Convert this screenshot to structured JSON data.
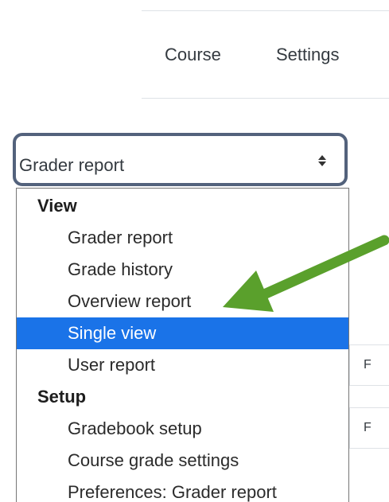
{
  "nav": {
    "tabs": [
      {
        "label": "Course"
      },
      {
        "label": "Settings"
      }
    ]
  },
  "report_select": {
    "selected_value": "Grader report",
    "arrow_icon": "sort-arrows-icon"
  },
  "dropdown": {
    "groups": [
      {
        "label": "View",
        "items": [
          {
            "label": "Grader report"
          },
          {
            "label": "Grade history"
          },
          {
            "label": "Overview report"
          },
          {
            "label": "Single view",
            "highlighted": true
          },
          {
            "label": "User report"
          }
        ]
      },
      {
        "label": "Setup",
        "items": [
          {
            "label": "Gradebook setup"
          },
          {
            "label": "Course grade settings"
          },
          {
            "label": "Preferences: Grader report"
          }
        ]
      }
    ],
    "highlight_color": "#1a73e8"
  },
  "background_table": {
    "cells": [
      "F",
      "F"
    ]
  },
  "annotation": {
    "arrow_color": "#5aa02c",
    "arrow_icon": "green-pointer-arrow"
  }
}
